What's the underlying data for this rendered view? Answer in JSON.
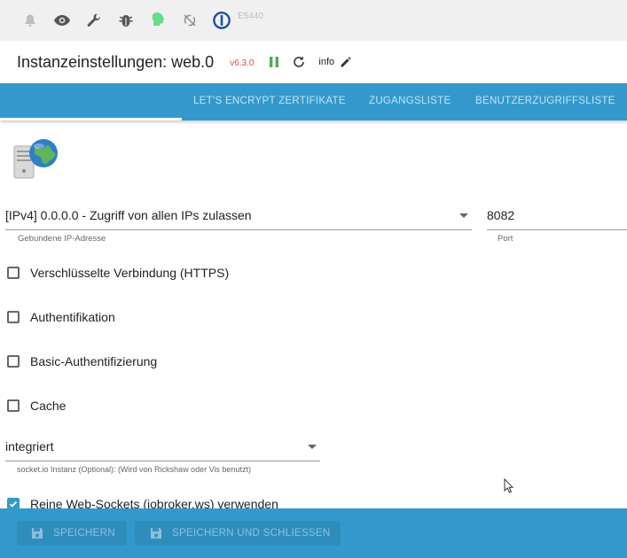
{
  "topbar": {
    "icons": [
      "bell-icon",
      "eye-icon",
      "wrench-icon",
      "bug-icon",
      "head-icon",
      "sync-off-icon",
      "iobroker-logo-icon"
    ],
    "host": "E5440"
  },
  "title": {
    "text": "Instanzeinstellungen: web.0",
    "version": "v6.3.0",
    "info": "info"
  },
  "tabs": [
    {
      "label": ""
    },
    {
      "label": "LET'S ENCRYPT ZERTIFIKATE"
    },
    {
      "label": "ZUGANGSLISTE"
    },
    {
      "label": "BENUTZERZUGRIFFSLISTE"
    }
  ],
  "form": {
    "bind_ip": {
      "value": "[IPv4] 0.0.0.0 - Zugriff von allen IPs zulassen",
      "helper": "Gebundene IP-Adresse"
    },
    "port": {
      "value": "8082",
      "helper": "Port"
    },
    "checkboxes": [
      {
        "label": "Verschlüsselte Verbindung (HTTPS)",
        "checked": false
      },
      {
        "label": "Authentifikation",
        "checked": false
      },
      {
        "label": "Basic-Authentifizierung",
        "checked": false
      },
      {
        "label": "Cache",
        "checked": false
      }
    ],
    "socketio": {
      "value": "integriert",
      "helper": "socket.io Instanz (Optional): (Wird von Rickshaw oder Vis benutzt)"
    },
    "websockets": {
      "label": "Reine Web-Sockets (iobroker.ws) verwenden",
      "checked": true
    }
  },
  "buttons": {
    "save": "SPEICHERN",
    "save_close": "SPEICHERN UND SCHLIESSEN"
  },
  "colors": {
    "accent": "#3399cc",
    "version": "#e54545",
    "running": "#4caf50",
    "connected": "#66dd88"
  }
}
